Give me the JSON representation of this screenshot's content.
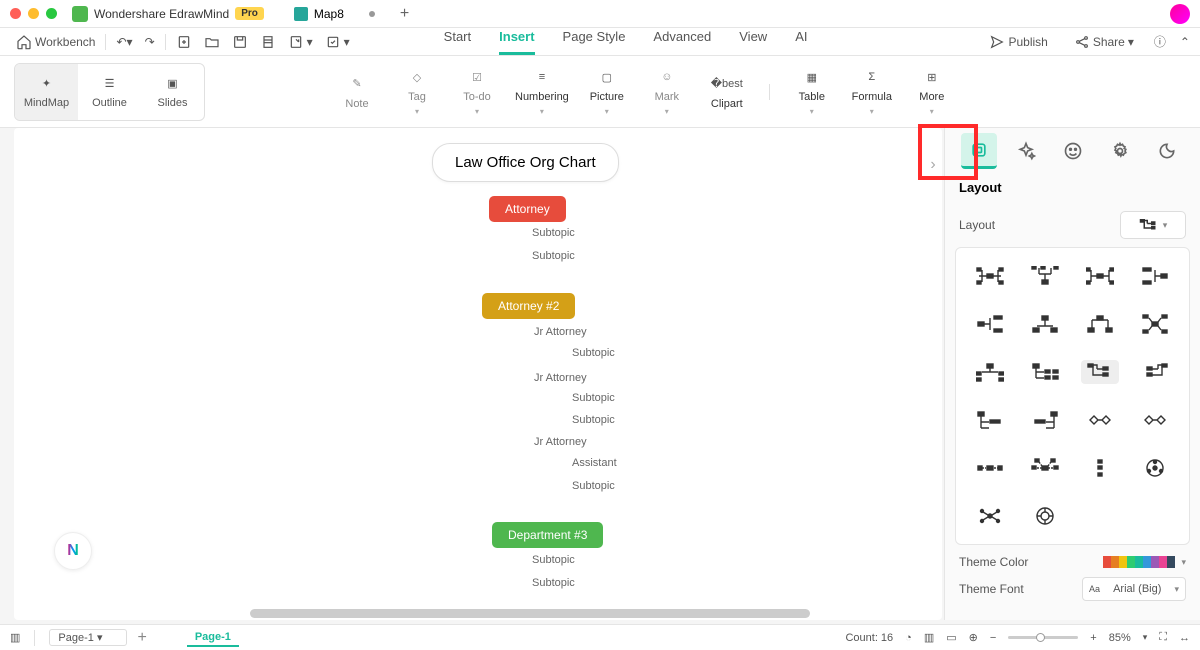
{
  "app": {
    "title": "Wondershare EdrawMind",
    "badge": "Pro"
  },
  "tab": {
    "title": "Map8"
  },
  "toolbar": {
    "workbench": "Workbench"
  },
  "menu": {
    "start": "Start",
    "insert": "Insert",
    "page_style": "Page Style",
    "advanced": "Advanced",
    "view": "View",
    "ai": "AI",
    "publish": "Publish",
    "share": "Share"
  },
  "views": {
    "mindmap": "MindMap",
    "outline": "Outline",
    "slides": "Slides"
  },
  "tools": {
    "note": "Note",
    "tag": "Tag",
    "todo": "To-do",
    "numbering": "Numbering",
    "picture": "Picture",
    "mark": "Mark",
    "clipart": "Clipart",
    "table": "Table",
    "formula": "Formula",
    "more": "More"
  },
  "canvas": {
    "root": "Law Office Org Chart",
    "a1": "Attorney",
    "a1s1": "Subtopic",
    "a1s2": "Subtopic",
    "a2": "Attorney #2",
    "a2s1": "Jr Attorney",
    "a2s1a": "Subtopic",
    "a2s2": "Jr Attorney",
    "a2s2a": "Subtopic",
    "a2s2b": "Subtopic",
    "a2s3": "Jr Attorney",
    "a2s3a": "Assistant",
    "a2s3b": "Subtopic",
    "a3": "Department #3",
    "a3s1": "Subtopic",
    "a3s2": "Subtopic"
  },
  "panel": {
    "title": "Layout",
    "layout_label": "Layout",
    "theme_color": "Theme Color",
    "theme_font": "Theme Font",
    "font_value": "Arial (Big)"
  },
  "theme_swatches": [
    "#e74c3c",
    "#e67e22",
    "#f1c40f",
    "#2ecc71",
    "#1abc9c",
    "#3498db",
    "#9b59b6",
    "#e84393",
    "#34495e"
  ],
  "bottom": {
    "page_select": "Page-1",
    "page_tab": "Page-1",
    "count": "Count: 16",
    "zoom": "85%"
  }
}
